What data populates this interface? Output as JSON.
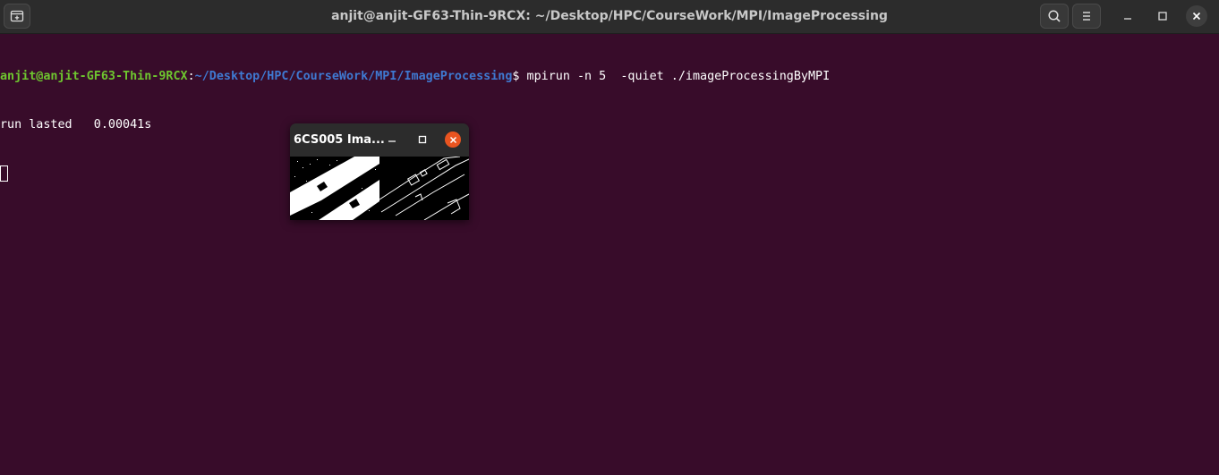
{
  "window": {
    "title": "anjit@anjit-GF63-Thin-9RCX: ~/Desktop/HPC/CourseWork/MPI/ImageProcessing"
  },
  "terminal": {
    "prompt_user": "anjit@anjit-GF63-Thin-9RCX",
    "prompt_sep": ":",
    "prompt_path": "~/Desktop/HPC/CourseWork/MPI/ImageProcessing",
    "prompt_symbol": "$ ",
    "command": "mpirun -n 5  -quiet ./imageProcessingByMPI",
    "output_line": "run lasted   0.00041s"
  },
  "image_window": {
    "title": "6CS005 Ima..."
  },
  "icons": {
    "new_tab": "new-tab-icon",
    "search": "search-icon",
    "menu": "hamburger-menu-icon",
    "minimize": "minimize-icon",
    "maximize": "maximize-icon",
    "close": "close-icon"
  },
  "colors": {
    "terminal_bg": "#380c2a",
    "prompt_user": "#6ec62f",
    "prompt_path": "#3f79d1",
    "close_accent": "#e95420"
  }
}
